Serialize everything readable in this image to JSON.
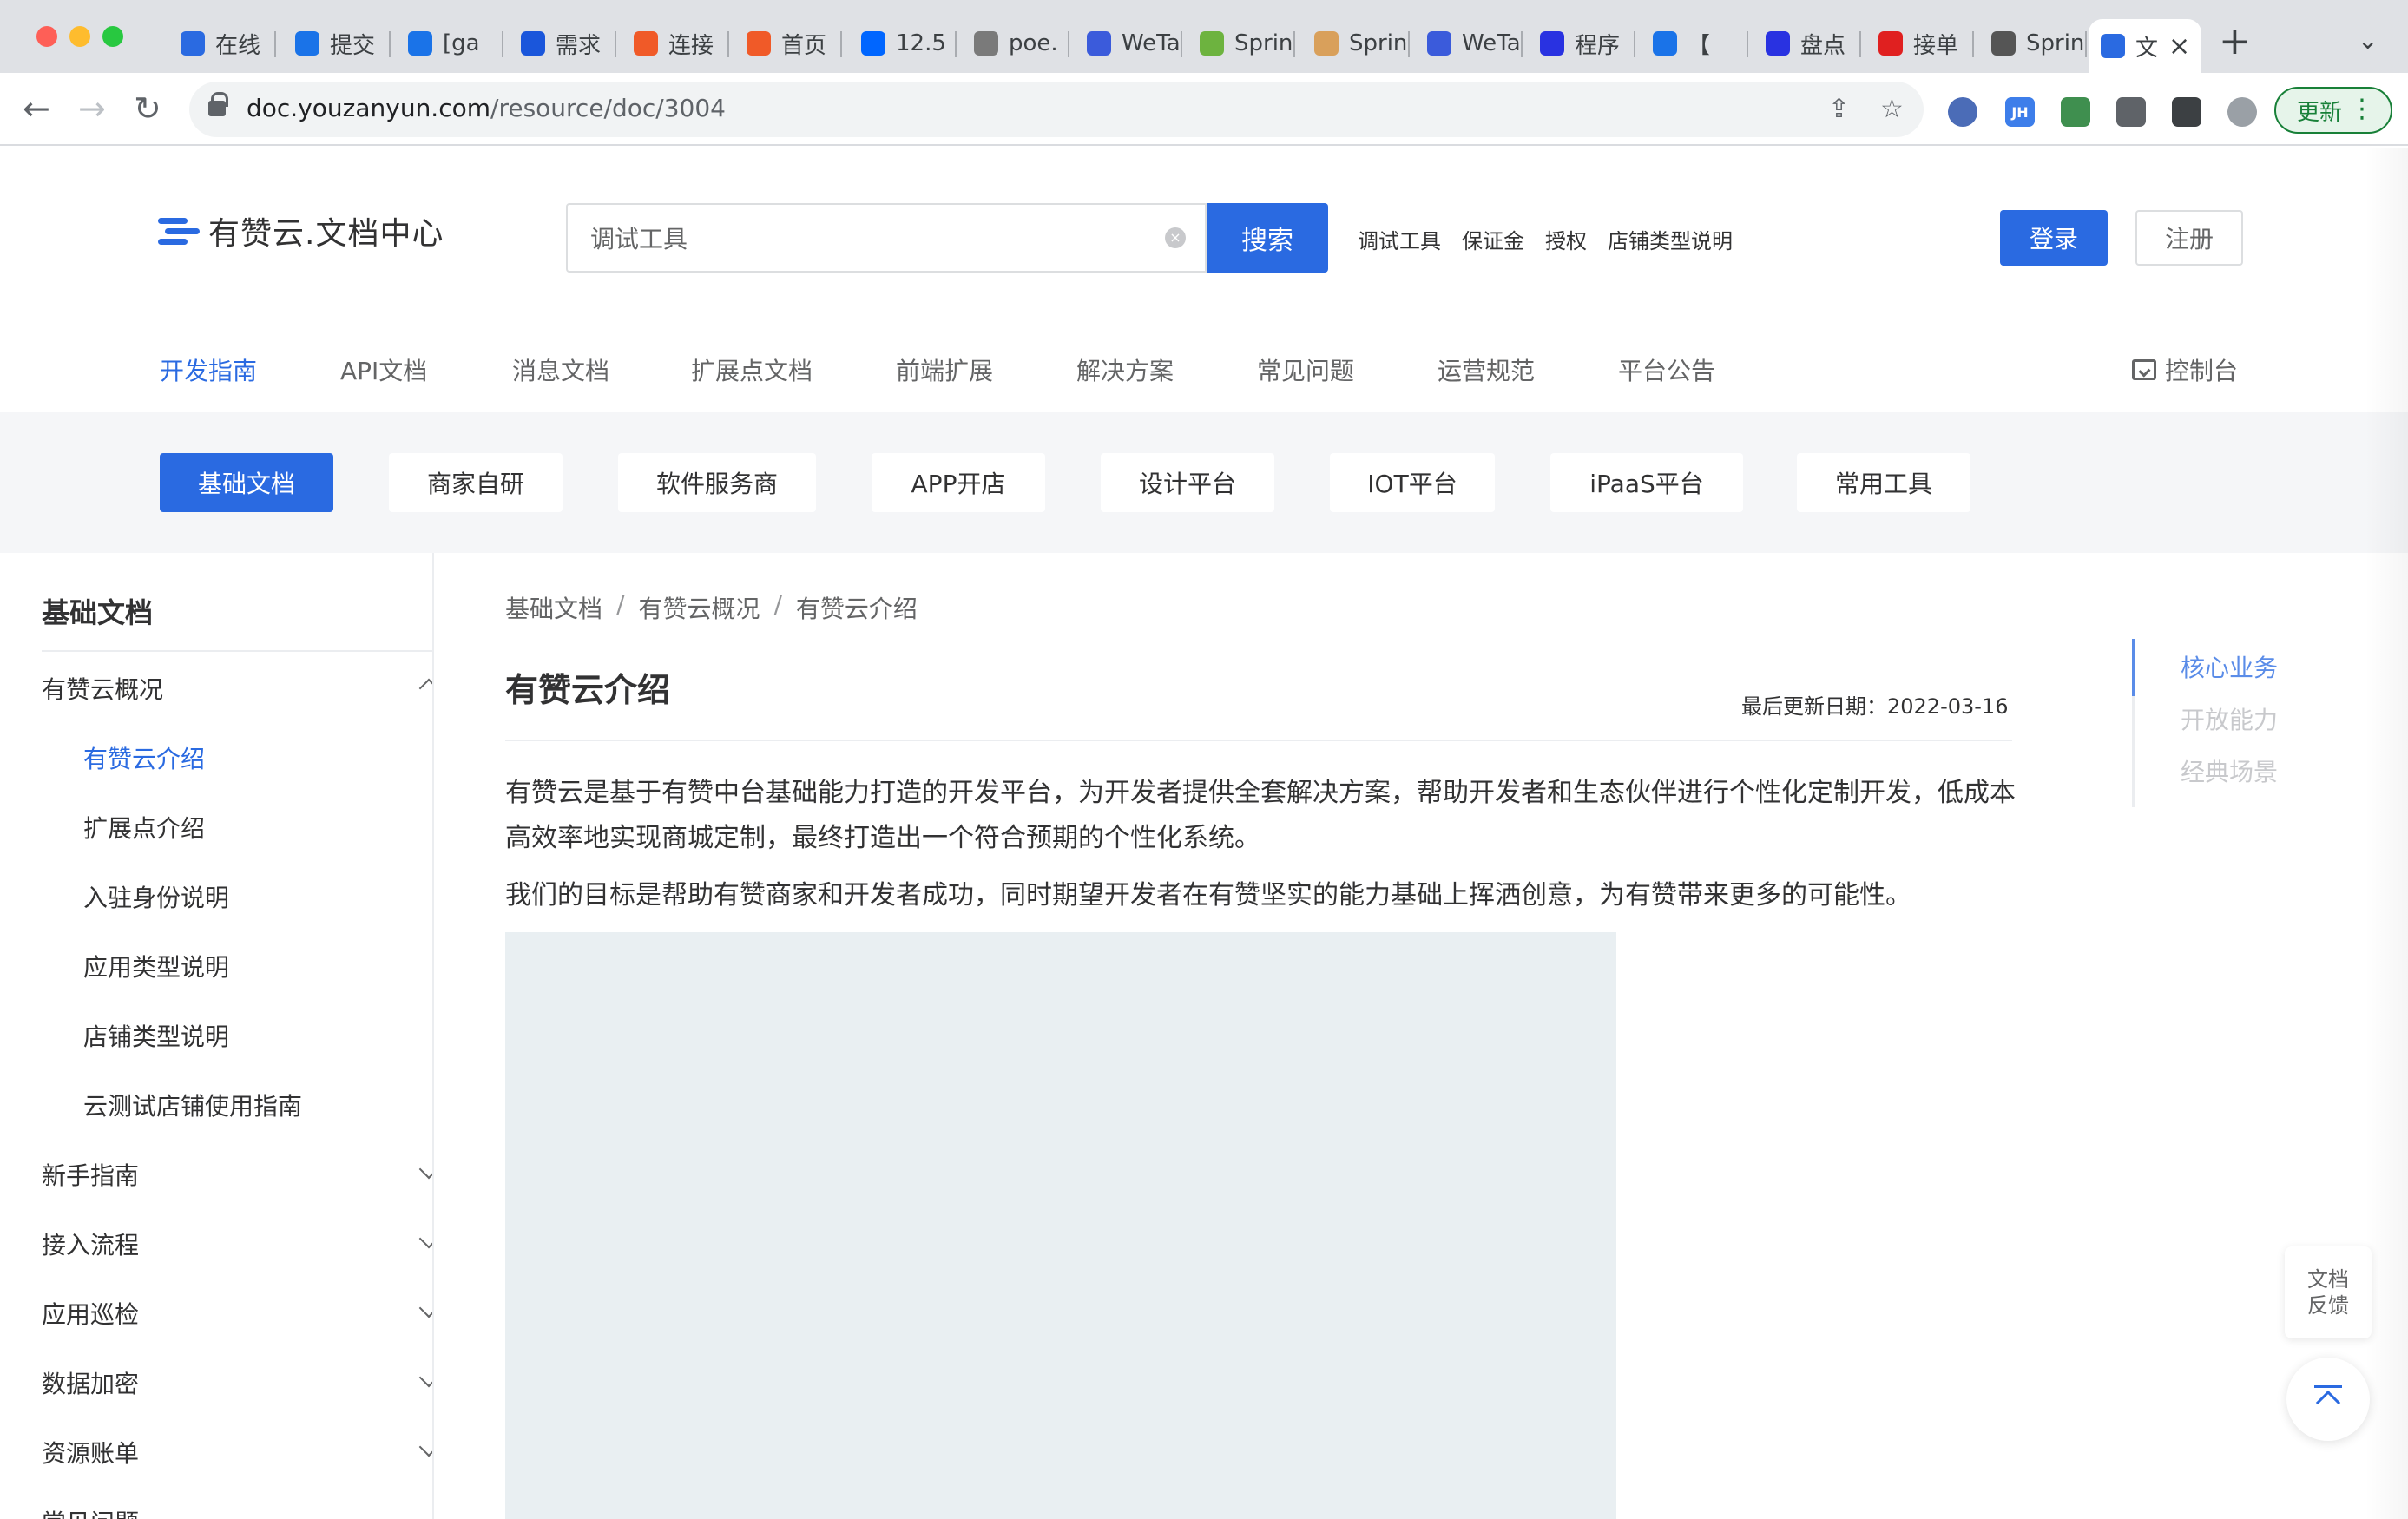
{
  "browser": {
    "tabs": [
      {
        "label": "在线",
        "icon": "in-online-icon",
        "color": "#2a6ae1"
      },
      {
        "label": "提交",
        "icon": "c-icon",
        "color": "#1a73e8"
      },
      {
        "label": "[ga",
        "icon": "f-icon",
        "color": "#1a73e8"
      },
      {
        "label": "需求",
        "icon": "x-icon",
        "color": "#1a56db"
      },
      {
        "label": "连接",
        "icon": "link-icon",
        "color": "#f05a28"
      },
      {
        "label": "首页",
        "icon": "link-icon",
        "color": "#f05a28"
      },
      {
        "label": "12.5",
        "icon": "zhihu-icon",
        "color": "#0066ff"
      },
      {
        "label": "poe.",
        "icon": "chat-icon",
        "color": "#7a7a7a"
      },
      {
        "label": "WeTa",
        "icon": "wetalk-icon",
        "color": "#3b5bdb"
      },
      {
        "label": "Sprin",
        "icon": "leaf-icon",
        "color": "#6db33f"
      },
      {
        "label": "Sprin",
        "icon": "avatar-icon",
        "color": "#d9a05b"
      },
      {
        "label": "WeTa",
        "icon": "wetalk-icon",
        "color": "#3b5bdb"
      },
      {
        "label": "程序",
        "icon": "paw-icon",
        "color": "#2932e1"
      },
      {
        "label": "【",
        "icon": "terminal-icon",
        "color": "#1a73e8"
      },
      {
        "label": "盘点",
        "icon": "paw-icon",
        "color": "#2932e1"
      },
      {
        "label": "接单",
        "icon": "ep-icon",
        "color": "#e02020"
      },
      {
        "label": "Sprin",
        "icon": "swirl-icon",
        "color": "#555555"
      },
      {
        "label": "文",
        "icon": "doc-icon",
        "color": "#2a6ae1",
        "active": true
      }
    ],
    "url_host": "doc.youzanyun.com",
    "url_path": "/resource/doc/3004",
    "update_label": "更新",
    "ext_jh": "JH"
  },
  "header": {
    "logo_text": "有赞云.文档中心",
    "search": {
      "value": "调试工具",
      "button": "搜索"
    },
    "hot_links": [
      "调试工具",
      "保证金",
      "授权",
      "店铺类型说明"
    ],
    "login": "登录",
    "signup": "注册",
    "nav": [
      "开发指南",
      "API文档",
      "消息文档",
      "扩展点文档",
      "前端扩展",
      "解决方案",
      "常见问题",
      "运营规范",
      "平台公告"
    ],
    "nav_active_index": 0,
    "console": "控制台"
  },
  "categories": {
    "items": [
      "基础文档",
      "商家自研",
      "软件服务商",
      "APP开店",
      "设计平台",
      "IOT平台",
      "iPaaS平台",
      "常用工具"
    ],
    "active_index": 0
  },
  "sidebar": {
    "title": "基础文档",
    "groups": [
      {
        "label": "有赞云概况",
        "expanded": true
      },
      {
        "label": "新手指南",
        "expanded": false
      },
      {
        "label": "接入流程",
        "expanded": false
      },
      {
        "label": "应用巡检",
        "expanded": false
      },
      {
        "label": "数据加密",
        "expanded": false
      },
      {
        "label": "资源账单",
        "expanded": false
      },
      {
        "label": "常见问题",
        "expanded": false
      }
    ],
    "sub_items": [
      "有赞云介绍",
      "扩展点介绍",
      "入驻身份说明",
      "应用类型说明",
      "店铺类型说明",
      "云测试店铺使用指南"
    ],
    "active_sub_index": 0
  },
  "content": {
    "breadcrumb": [
      "基础文档",
      "有赞云概况",
      "有赞云介绍"
    ],
    "title": "有赞云介绍",
    "updated": "最后更新日期：2022-03-16",
    "paragraphs": [
      "有赞云是基于有赞中台基础能力打造的开发平台，为开发者提供全套解决方案，帮助开发者和生态伙伴进行个性化定制开发，低成本高效率地实现商城定制，最终打造出一个符合预期的个性化系统。",
      "我们的目标是帮助有赞商家和开发者成功，同时期望开发者在有赞坚实的能力基础上挥洒创意，为有赞带来更多的可能性。"
    ]
  },
  "toc": {
    "items": [
      "核心业务",
      "开放能力",
      "经典场景"
    ],
    "active_index": 0
  },
  "widgets": {
    "feedback_line1": "文档",
    "feedback_line2": "反馈"
  },
  "colors": {
    "primary": "#2a6ae1",
    "text": "#323233",
    "muted": "#646566",
    "toc_active": "#5a8ce8",
    "category_bg": "#f5f6f8",
    "image_placeholder": "#e9eff2"
  }
}
